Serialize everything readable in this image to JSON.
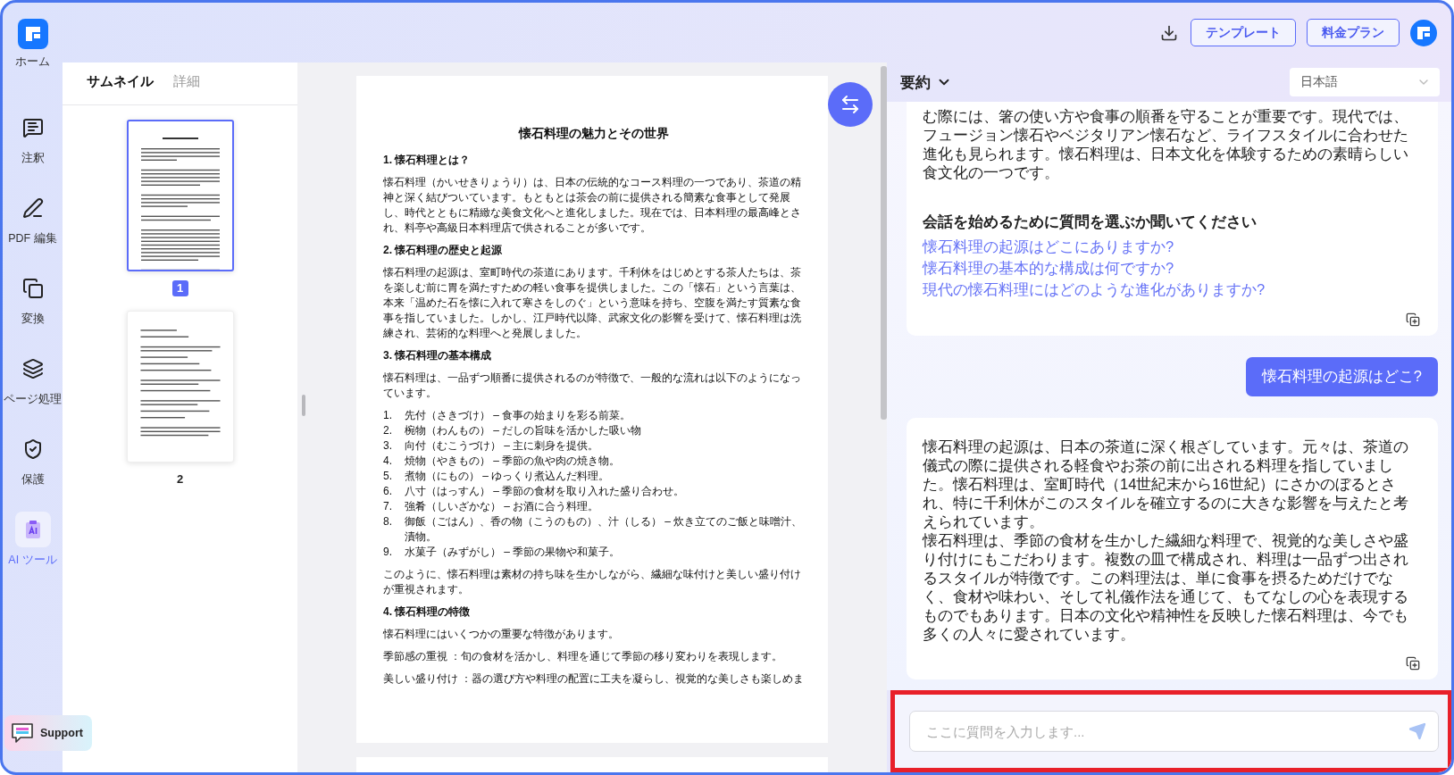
{
  "sidebar": {
    "items": [
      {
        "label": "ホーム",
        "kind": "home",
        "selected": false
      },
      {
        "label": "注釈",
        "kind": "comment",
        "selected": false
      },
      {
        "label": "PDF 編集",
        "kind": "edit",
        "selected": false
      },
      {
        "label": "変換",
        "kind": "convert",
        "selected": false
      },
      {
        "label": "ページ処理",
        "kind": "layers",
        "selected": false
      },
      {
        "label": "保護",
        "kind": "protect",
        "selected": false
      },
      {
        "label": "AI ツール",
        "kind": "ai",
        "selected": true
      }
    ],
    "support": "Support"
  },
  "topbar": {
    "buttons": [
      "テンプレート",
      "料金プラン"
    ]
  },
  "thumbnails": {
    "tabs": [
      {
        "label": "サムネイル",
        "selected": true
      },
      {
        "label": "詳細",
        "selected": false
      }
    ],
    "pages": [
      {
        "number": "1",
        "selected": true
      },
      {
        "number": "2",
        "selected": false
      }
    ]
  },
  "document": {
    "title": "懐石料理の魅力とその世界",
    "blocks": [
      {
        "kind": "heading",
        "text": "1.  懐石料理とは？"
      },
      {
        "kind": "paragraph",
        "text": "懐石料理（かいせきりょうり）は、日本の伝統的なコース料理の一つであり、茶道の精神と深く結びついています。もともとは茶会の前に提供される簡素な食事として発展し、時代とともに精緻な美食文化へと進化しました。現在では、日本料理の最高峰とされ、料亭や高級日本料理店で供されることが多いです。"
      },
      {
        "kind": "heading",
        "text": "2.  懐石料理の歴史と起源"
      },
      {
        "kind": "paragraph",
        "text": "懐石料理の起源は、室町時代の茶道にあります。千利休をはじめとする茶人たちは、茶を楽しむ前に胃を満たすための軽い食事を提供しました。この「懐石」という言葉は、本来「温めた石を懐に入れて寒さをしのぐ」という意味を持ち、空腹を満たす質素な食事を指していました。しかし、江戸時代以降、武家文化の影響を受けて、懐石料理は洗練され、芸術的な料理へと発展しました。"
      },
      {
        "kind": "heading",
        "text": "3.  懐石料理の基本構成"
      },
      {
        "kind": "paragraph",
        "text": "懐石料理は、一品ずつ順番に提供されるのが特徴で、一般的な流れは以下のようになっています。"
      },
      {
        "kind": "list",
        "items": [
          {
            "number": "1.",
            "text": "先付（さきづけ） – 食事の始まりを彩る前菜。"
          },
          {
            "number": "2.",
            "text": "椀物（わんもの） – だしの旨味を活かした吸い物"
          },
          {
            "number": "3.",
            "text": "向付（むこうづけ） – 主に刺身を提供。"
          },
          {
            "number": "4.",
            "text": "焼物（やきもの） – 季節の魚や肉の焼き物。"
          },
          {
            "number": "5.",
            "text": "煮物（にもの） – ゆっくり煮込んだ料理。"
          },
          {
            "number": "6.",
            "text": "八寸（はっすん） – 季節の食材を取り入れた盛り合わせ。"
          },
          {
            "number": "7.",
            "text": "強肴（しいざかな） – お酒に合う料理。"
          },
          {
            "number": "8.",
            "text": "御飯（ごはん）、香の物（こうのもの）、汁（しる） – 炊き立てのご飯と味噌汁、漬物。"
          },
          {
            "number": "9.",
            "text": "水菓子（みずがし） – 季節の果物や和菓子。"
          }
        ]
      },
      {
        "kind": "paragraph",
        "text": "このように、懐石料理は素材の持ち味を生かしながら、繊細な味付けと美しい盛り付けが重視されます。"
      },
      {
        "kind": "heading",
        "text": "4.  懐石料理の特徴"
      },
      {
        "kind": "paragraph",
        "text": "懐石料理にはいくつかの重要な特徴があります。"
      },
      {
        "kind": "paragraph",
        "text": "季節感の重視 ：旬の食材を活かし、料理を通じて季節の移り変わりを表現します。"
      },
      {
        "kind": "paragraph",
        "text": "美しい盛り付け ：器の選び方や料理の配置に工夫を凝らし、視覚的な美しさも楽しめま"
      }
    ]
  },
  "assistant": {
    "mode": "要約",
    "language": "日本語",
    "messages": [
      {
        "kind": "answer",
        "paragraphs": [
          "む際には、箸の使い方や食事の順番を守ることが重要です。現代では、フュージョン懐石やベジタリアン懐石など、ライフスタイルに合わせた進化も見られます。懐石料理は、日本文化を体験するための素晴らしい食文化の一つです。"
        ],
        "prompt": "会話を始めるために質問を選ぶか聞いてください",
        "suggestions": [
          "懐石料理の起源はどこにありますか?",
          "懐石料理の基本的な構成は何ですか?",
          "現代の懐石料理にはどのような進化がありますか?"
        ]
      },
      {
        "kind": "question",
        "text": "懐石料理の起源はどこ?"
      },
      {
        "kind": "answer",
        "paragraphs": [
          "懐石料理の起源は、日本の茶道に深く根ざしています。元々は、茶道の儀式の際に提供される軽食やお茶の前に出される料理を指していました。懐石料理は、室町時代（14世紀末から16世紀）にさかのぼるとされ、特に千利休がこのスタイルを確立するのに大きな影響を与えたと考えられています。",
          "懐石料理は、季節の食材を生かした繊細な料理で、視覚的な美しさや盛り付けにもこだわります。複数の皿で構成され、料理は一品ずつ出されるスタイルが特徴です。この料理法は、単に食事を摂るためだけでなく、食材や味わい、そして礼儀作法を通じて、もてなしの心を表現するものでもあります。日本の文化や精神性を反映した懐石料理は、今でも多くの人々に愛されています。"
        ]
      }
    ],
    "input": {
      "placeholder": "ここに質問を入力します..."
    }
  }
}
